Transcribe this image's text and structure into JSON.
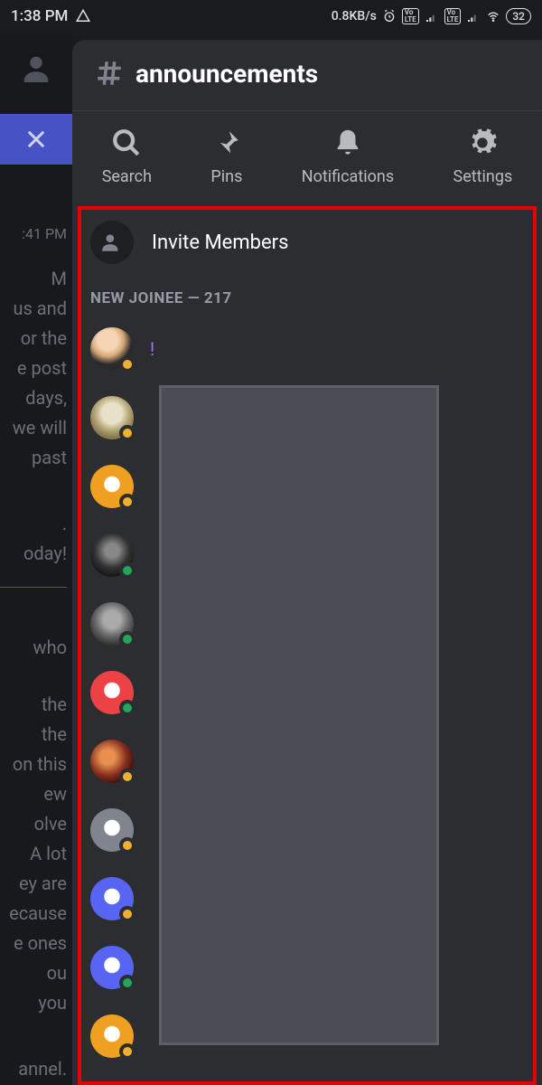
{
  "status_bar": {
    "time": "1:38 PM",
    "network_speed": "0.8KB/s",
    "battery": "32"
  },
  "channel": {
    "name": "announcements"
  },
  "actions": {
    "search": "Search",
    "pins": "Pins",
    "notifications": "Notifications",
    "settings": "Settings"
  },
  "invite_label": "Invite Members",
  "section": {
    "label": "NEW JOINEE — 217"
  },
  "members": [
    {
      "name": "!",
      "status": "idle",
      "avatar_type": "photo1"
    },
    {
      "name": "",
      "status": "idle",
      "avatar_type": "photo2"
    },
    {
      "name": "",
      "status": "idle",
      "avatar_type": "discord-orange"
    },
    {
      "name": "",
      "status": "online",
      "avatar_type": "photo3"
    },
    {
      "name": "",
      "status": "online",
      "avatar_type": "photo4"
    },
    {
      "name": "",
      "status": "online",
      "avatar_type": "discord-red"
    },
    {
      "name": "",
      "status": "idle",
      "avatar_type": "photo5"
    },
    {
      "name": "",
      "status": "idle",
      "avatar_type": "discord-gray"
    },
    {
      "name": "",
      "status": "idle",
      "avatar_type": "discord-blurple"
    },
    {
      "name": "",
      "status": "online",
      "avatar_type": "discord-blurple"
    },
    {
      "name": "",
      "status": "idle",
      "avatar_type": "discord-orange"
    }
  ],
  "bg_snippets": {
    "ts": ":41 PM",
    "p1": "M\nus and\nor the\ne post\ndays,\nwe will\npast",
    "p2": ".\noday!",
    "p3": "who",
    "p4": "the\nthe\non this\new\nolve\nA lot\ney are\necause\ne ones\nou\nyou",
    "p5": "annel."
  }
}
